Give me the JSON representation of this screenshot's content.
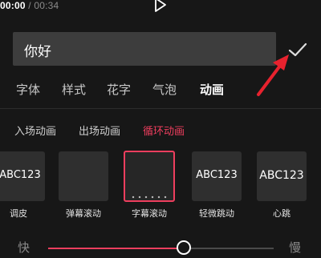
{
  "player": {
    "current_time": "00:00",
    "separator": "/",
    "total_time": "00:34"
  },
  "text_input": {
    "value": "你好"
  },
  "tabs": [
    {
      "label": "字体",
      "active": false
    },
    {
      "label": "样式",
      "active": false
    },
    {
      "label": "花字",
      "active": false
    },
    {
      "label": "气泡",
      "active": false
    },
    {
      "label": "动画",
      "active": true
    }
  ],
  "subtabs": [
    {
      "label": "入场动画",
      "active": false
    },
    {
      "label": "出场动画",
      "active": false
    },
    {
      "label": "循环动画",
      "active": true
    }
  ],
  "animations": [
    {
      "preview": "ABC123",
      "name": "调皮"
    },
    {
      "preview": "",
      "name": "弹幕滚动"
    },
    {
      "preview": "",
      "name": "字幕滚动",
      "selected": true
    },
    {
      "preview": "ABC123",
      "name": "轻微跳动"
    },
    {
      "preview": "ABC123",
      "name": "心跳"
    }
  ],
  "speed": {
    "min_label": "快",
    "max_label": "慢",
    "value_fraction": 0.6
  },
  "colors": {
    "accent": "#ee3e5e",
    "background": "#171717",
    "input_bg": "#3d3d3d",
    "tile_bg": "#2f2f2f",
    "annotation_arrow": "#e8222e"
  },
  "icons": {
    "play": "play-icon",
    "confirm": "checkmark-icon",
    "annotation": "red-arrow-icon"
  }
}
